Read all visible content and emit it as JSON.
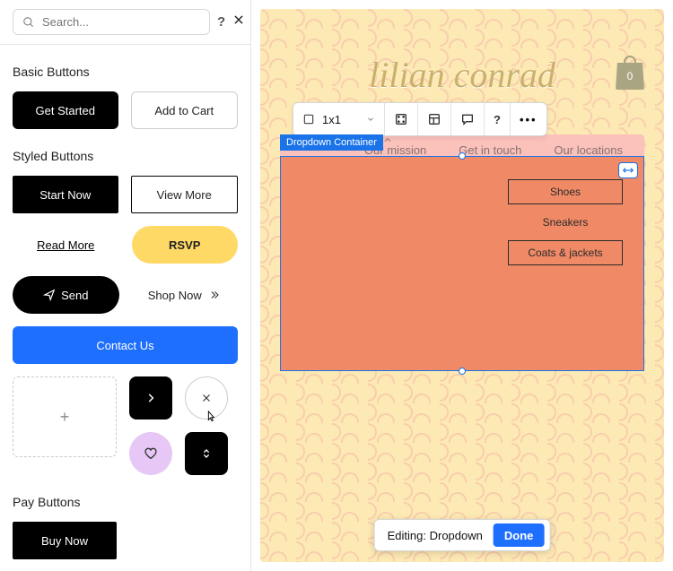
{
  "panel": {
    "search_placeholder": "Search...",
    "sections": {
      "basic": "Basic Buttons",
      "styled": "Styled Buttons",
      "pay": "Pay Buttons"
    },
    "buttons": {
      "get_started": "Get Started",
      "add_to_cart": "Add to Cart",
      "start_now": "Start Now",
      "view_more": "View More",
      "read_more": "Read More",
      "rsvp": "RSVP",
      "send": "Send",
      "shop_now": "Shop Now",
      "contact_us": "Contact Us",
      "buy_now": "Buy Now"
    }
  },
  "site": {
    "brand": "lilian conrad",
    "bag_count": "0",
    "nav": [
      "Our mission",
      "Get in touch",
      "Our locations"
    ],
    "toolbar": {
      "grid_label": "1x1"
    },
    "selection_tag": "Dropdown Container",
    "menu_items": [
      "Shoes",
      "Sneakers",
      "Coats & jackets"
    ],
    "edit_bar": {
      "label": "Editing: Dropdown",
      "done": "Done"
    }
  }
}
